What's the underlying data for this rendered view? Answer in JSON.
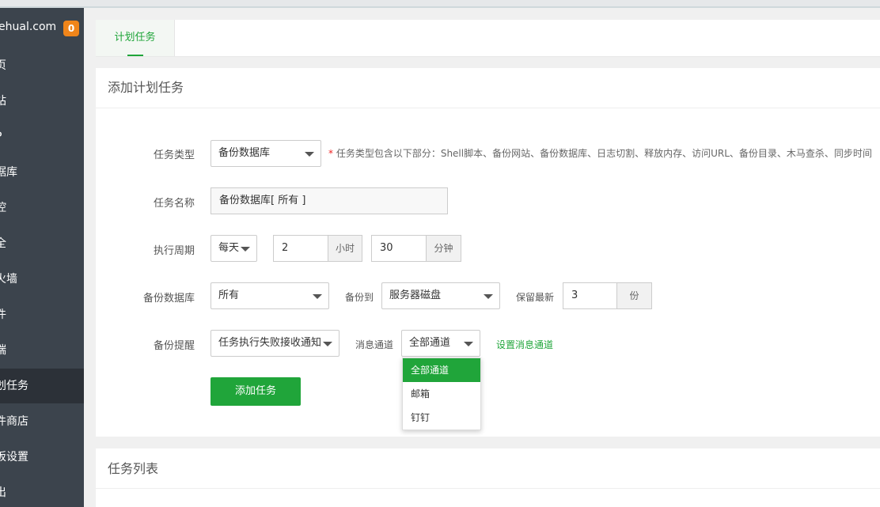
{
  "sidebar": {
    "brand": "ehual.com",
    "badge": "0",
    "items": [
      {
        "label": "页"
      },
      {
        "label": "站"
      },
      {
        "label": "P"
      },
      {
        "label": "据库"
      },
      {
        "label": "控"
      },
      {
        "label": "全"
      },
      {
        "label": "火墙"
      },
      {
        "label": "件"
      },
      {
        "label": "端"
      },
      {
        "label": "划任务",
        "active": true
      },
      {
        "label": "件商店"
      },
      {
        "label": "板设置"
      },
      {
        "label": "出"
      }
    ]
  },
  "tabs": [
    {
      "label": "计划任务",
      "active": true
    }
  ],
  "add_task": {
    "title": "添加计划任务",
    "task_type": {
      "label": "任务类型",
      "value": "备份数据库"
    },
    "hint_star": "*",
    "hint": "任务类型包含以下部分：Shell脚本、备份网站、备份数据库、日志切割、释放内存、访问URL、备份目录、木马查杀、同步时间",
    "task_name": {
      "label": "任务名称",
      "value": "备份数据库[ 所有 ]"
    },
    "period": {
      "label": "执行周期",
      "cycle": "每天",
      "hour": "2",
      "hour_unit": "小时",
      "minute": "30",
      "minute_unit": "分钟"
    },
    "backup_db": {
      "label": "备份数据库",
      "value": "所有",
      "to_label": "备份到",
      "to_value": "服务器磁盘",
      "keep_label": "保留最新",
      "keep_value": "3",
      "keep_unit": "份"
    },
    "notify": {
      "label": "备份提醒",
      "value": "任务执行失败接收通知",
      "channel_label": "消息通道",
      "channel_value": "全部通道",
      "set_channel_link": "设置消息通道"
    },
    "channel_options": [
      "全部通道",
      "邮箱",
      "钉钉"
    ],
    "submit": "添加任务"
  },
  "task_list": {
    "title": "任务列表"
  },
  "colors": {
    "accent": "#20a53a",
    "sidebar_bg": "#3c444d",
    "badge": "#f0851a"
  }
}
